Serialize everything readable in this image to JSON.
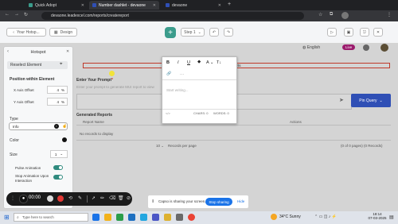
{
  "browser": {
    "tabs": [
      {
        "label": "Quick Adopt"
      },
      {
        "label": "Number dashlet - devaone"
      },
      {
        "label": "devaone"
      }
    ],
    "url": "devaone.leadexcel.com/reports/createreport",
    "profile": "Verify it's you"
  },
  "header": {
    "back_label": "Your Hotsp...",
    "design_label": "Design",
    "step_label": "Step 1",
    "language": "English",
    "live_label": "Live"
  },
  "hotspot_panel": {
    "title": "Hotspot",
    "reselect_label": "Reselect Element",
    "position_heading": "Position within Element",
    "x_label": "X Axis Offset",
    "x_value": "4",
    "x_unit": "%",
    "y_label": "Y Axis Offset",
    "y_value": "4",
    "y_unit": "%",
    "type_label": "Type",
    "type_value": "Info",
    "color_label": "Color",
    "size_label": "Size",
    "size_value": "1",
    "pulse_label": "Pulse Animation",
    "stop_label": "Stop Animation Upon Interaction"
  },
  "main": {
    "red_box_text": "orts",
    "prompt_label": "Enter Your Prompt",
    "prompt_placeholder": "Enter your prompt to generate MUI report to view",
    "pin_query": "Pin Query",
    "generated_heading": "Generated Reports",
    "col_report_name": "Report Name",
    "col_query_entered": "Query Entered",
    "col_actions": "Actions",
    "no_records": "No records to display",
    "rows_value": "10",
    "records_per_page": "Records per page",
    "pagination": "(0 of 0 pages) (0 Records)"
  },
  "editor": {
    "placeholder": "Start writing...",
    "chars_label": "CHARS: 0",
    "words_label": "WORDS: 0",
    "tb_bold": "B",
    "tb_italic": "I",
    "tb_underline": "U",
    "tb_fontsize": "T↓",
    "tb_link": "🔗"
  },
  "recorder": {
    "time": "00:00"
  },
  "share": {
    "message": "Capso is sharing your screen.",
    "stop_label": "Stop sharing",
    "hide_label": "Hide"
  },
  "taskbar": {
    "search_placeholder": "Type here to search",
    "weather": "34°C  Sunny",
    "time": "18:14",
    "date": "07-03-2025"
  },
  "colors": {
    "accent": "#3b9c8c",
    "pin_query": "#2f4fb5",
    "live": "#9b1b6d"
  }
}
